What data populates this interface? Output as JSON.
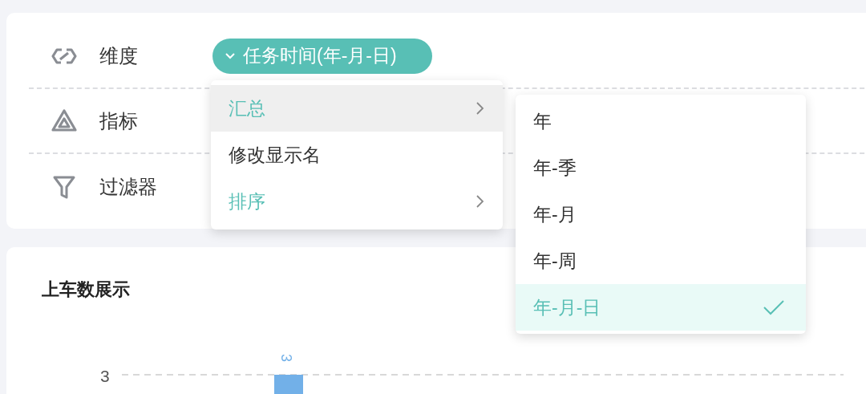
{
  "fields": [
    {
      "kind": "dimension",
      "label": "维度",
      "chip": "任务时间(年-月-日)"
    },
    {
      "kind": "metric",
      "label": "指标"
    },
    {
      "kind": "filter",
      "label": "过滤器"
    }
  ],
  "menu": {
    "items": [
      {
        "label": "汇总",
        "kind": "submenu",
        "selected": true
      },
      {
        "label": "修改显示名",
        "kind": "plain",
        "selected": false
      },
      {
        "label": "排序",
        "kind": "submenu",
        "selected": false
      }
    ]
  },
  "submenu": {
    "items": [
      {
        "label": "年",
        "selected": false
      },
      {
        "label": "年-季",
        "selected": false
      },
      {
        "label": "年-月",
        "selected": false
      },
      {
        "label": "年-周",
        "selected": false
      },
      {
        "label": "年-月-日",
        "selected": true
      }
    ]
  },
  "chart_card": {
    "title": "上车数展示",
    "y_tick_label": "3",
    "bar_label": "3"
  }
}
